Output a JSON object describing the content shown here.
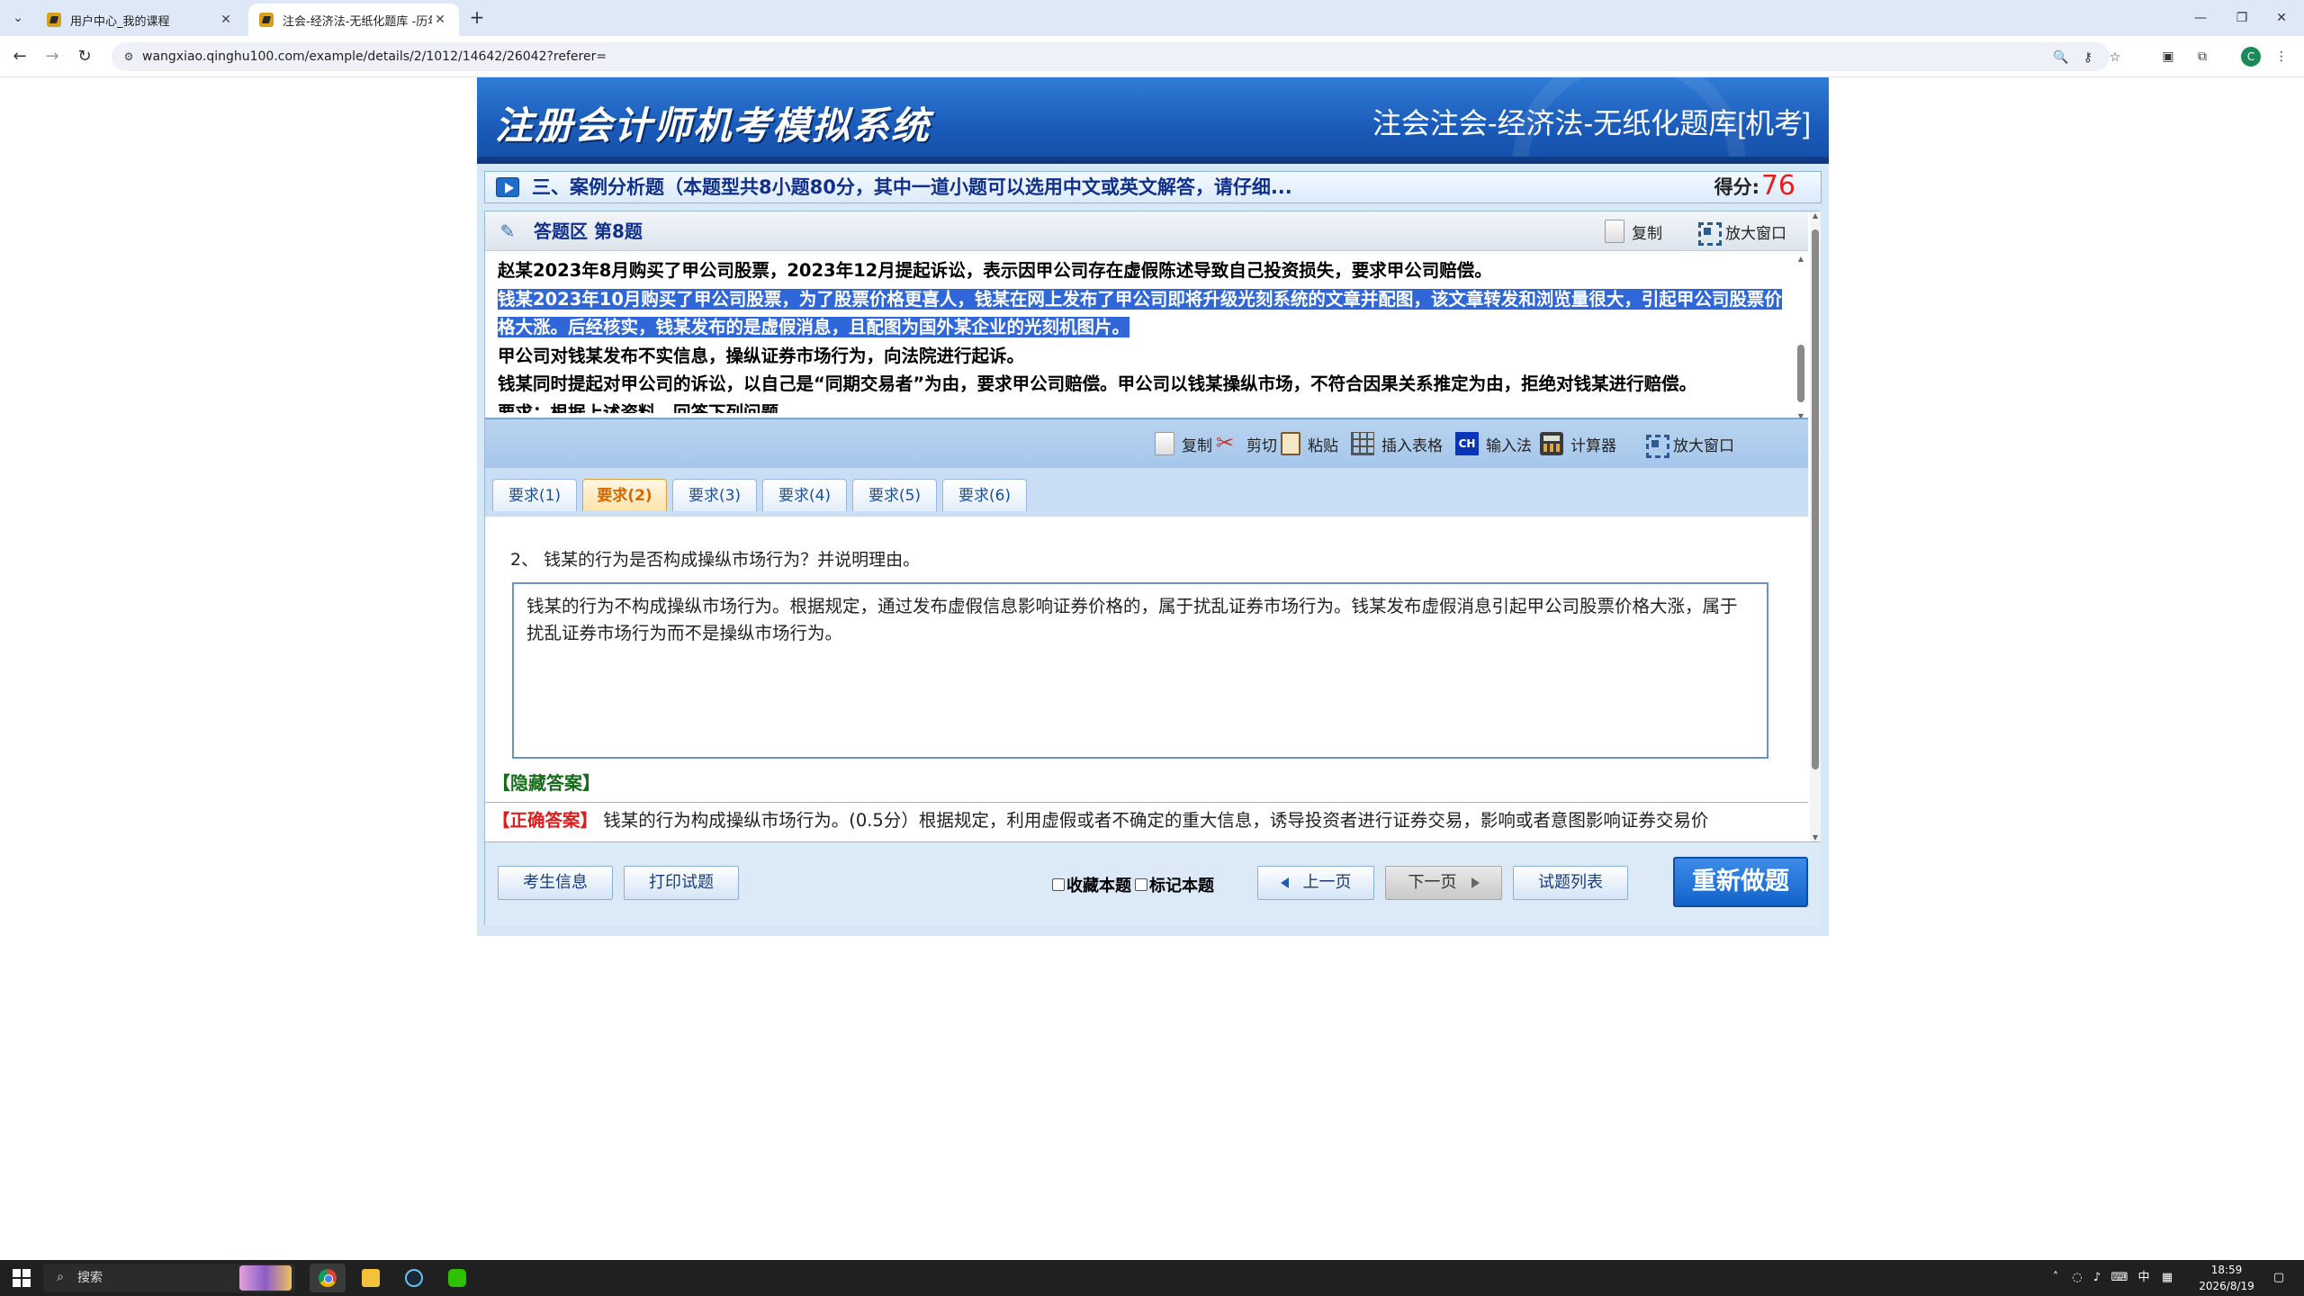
{
  "browser": {
    "tabs": [
      {
        "title": "用户中心_我的课程",
        "close": "✕"
      },
      {
        "title": "注会-经济法-无纸化题库 -历年",
        "close": "✕"
      }
    ],
    "new_tab": "+",
    "url": "wangxiao.qinghu100.com/example/details/2/1012/14642/26042?referer=",
    "profile_initial": "C",
    "window_controls": {
      "minimize": "—",
      "restore": "❐",
      "close": "✕"
    }
  },
  "header": {
    "system_title": "注册会计师机考模拟系统",
    "subject": "注会注会-经济法-无纸化题库[机考]"
  },
  "section": {
    "text": "三、案例分析题（本题型共8小题80分，其中一道小题可以选用中文或英文解答，请仔细...",
    "score_label": "得分:",
    "score_value": "76"
  },
  "answer_area": {
    "title": "答题区 第8题",
    "copy": "复制",
    "enlarge": "放大窗口"
  },
  "question": {
    "p1": "赵某2023年8月购买了甲公司股票，2023年12月提起诉讼，表示因甲公司存在虚假陈述导致自己投资损失，要求甲公司赔偿。",
    "p2": "钱某2023年10月购买了甲公司股票，为了股票价格更喜人，钱某在网上发布了甲公司即将升级光刻系统的文章并配图，该文章转发和浏览量很大，引起甲公司股票价格大涨。后经核实，钱某发布的是虚假消息，且配图为国外某企业的光刻机图片。",
    "p3": "甲公司对钱某发布不实信息，操纵证券市场行为，向法院进行起诉。",
    "p4": "钱某同时提起对甲公司的诉讼，以自己是“同期交易者”为由，要求甲公司赔偿。甲公司以钱某操纵市场，不符合因果关系推定为由，拒绝对钱某进行赔偿。",
    "p5": "要求：根据上述资料，回答下列问题。"
  },
  "toolbar": {
    "copy": "复制",
    "cut": "剪切",
    "paste": "粘贴",
    "insert_table": "插入表格",
    "ime": "输入法",
    "ime_icon": "CH",
    "calculator": "计算器",
    "enlarge": "放大窗口"
  },
  "requirement_tabs": [
    {
      "label": "要求(1)"
    },
    {
      "label": "要求(2)"
    },
    {
      "label": "要求(3)"
    },
    {
      "label": "要求(4)"
    },
    {
      "label": "要求(5)"
    },
    {
      "label": "要求(6)"
    }
  ],
  "active_tab_index": 1,
  "sub_question": "2、 钱某的行为是否构成操纵市场行为？并说明理由。",
  "user_answer": "钱某的行为不构成操纵市场行为。根据规定，通过发布虚假信息影响证券价格的，属于扰乱证券市场行为。钱某发布虚假消息引起甲公司股票价格大涨，属于扰乱证券市场行为而不是操纵市场行为。",
  "hide_answer": "【隐藏答案】",
  "correct_answer": {
    "label": "【正确答案】",
    "text": "钱某的行为构成操纵市场行为。(0.5分）根据规定，利用虚假或者不确定的重大信息，诱导投资者进行证券交易，影响或者意图影响证券交易价"
  },
  "bottom": {
    "candidate_info": "考生信息",
    "print": "打印试题",
    "favorite": "收藏本题",
    "mark": "标记本题",
    "prev": "上一页",
    "next": "下一页",
    "list": "试题列表",
    "redo": "重新做题"
  },
  "taskbar": {
    "search": "搜索",
    "ime": "中",
    "time": "18:59",
    "date": "2026/8/19"
  }
}
